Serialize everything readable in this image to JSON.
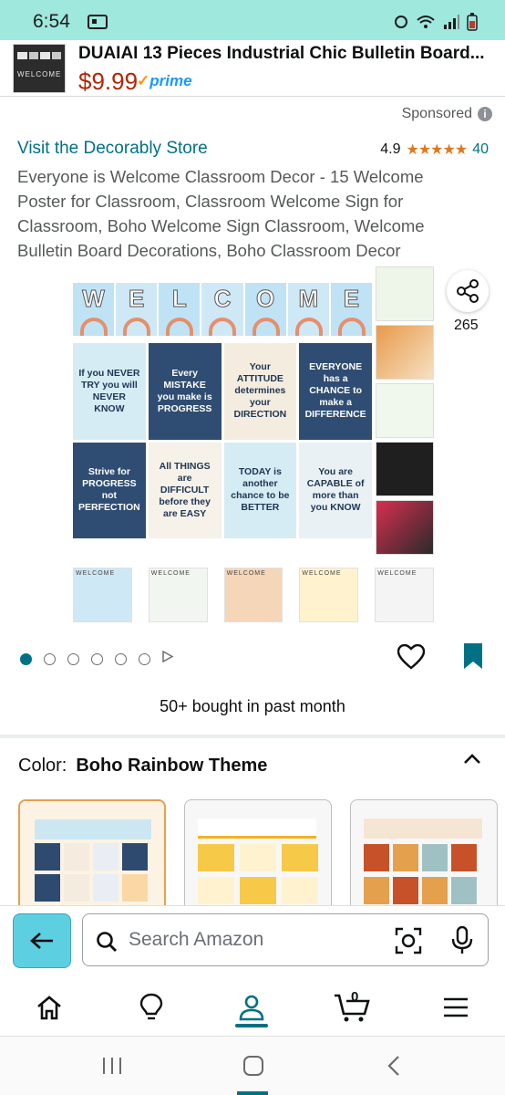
{
  "status": {
    "time": "6:54"
  },
  "sticky": {
    "title": "DUAIAI 13 Pieces Industrial Chic Bulletin Board...",
    "price": "$9.99",
    "prime": "prime",
    "thumb_text": "WELCOME"
  },
  "sponsored": "Sponsored",
  "store": {
    "link": "Visit the Decorably Store"
  },
  "rating": {
    "value": "4.9",
    "stars": "★★★★★",
    "count": "40"
  },
  "product": {
    "title": "Everyone is Welcome Classroom Decor - 15 Welcome Poster for Classroom, Classroom Welcome Sign for Classroom, Boho Welcome Sign Classroom, Welcome Bulletin Board Decorations, Boho Classroom Decor"
  },
  "gallery": {
    "banner_letters": [
      "W",
      "E",
      "L",
      "C",
      "O",
      "M",
      "E"
    ],
    "posters": [
      "If you NEVER TRY you will NEVER KNOW",
      "Every MISTAKE you make is PROGRESS",
      "Your ATTITUDE determines your DIRECTION",
      "EVERYONE has a CHANCE to make a DIFFERENCE",
      "Strive for PROGRESS not PERFECTION",
      "All THINGS are DIFFICULT before they are EASY",
      "TODAY is another chance to be BETTER",
      "You are CAPABLE of more than you KNOW"
    ],
    "thumb_label": "WELCOME"
  },
  "share": {
    "count": "265"
  },
  "carousel": {
    "total_dots": 6,
    "active_index": 0
  },
  "bought": "50+ bought in past month",
  "color": {
    "label": "Color:",
    "value": "Boho Rainbow Theme"
  },
  "search": {
    "placeholder": "Search Amazon"
  },
  "cart": {
    "count": "0"
  },
  "colors": {
    "accent": "#007185",
    "price": "#b12704",
    "star": "#de7921",
    "status_bar": "#9fe8de",
    "back_button": "#5ccfe0"
  }
}
